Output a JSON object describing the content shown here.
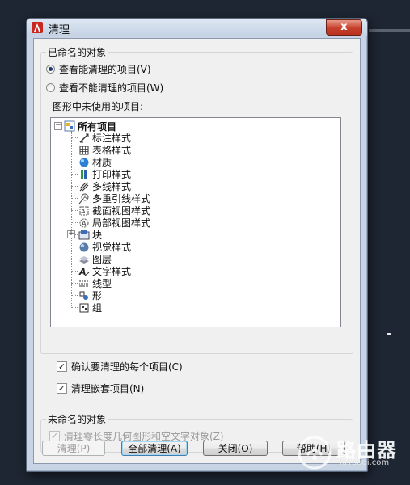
{
  "window": {
    "title": "清理",
    "close_glyph": "x"
  },
  "named_group": {
    "title": "已命名的对象",
    "radio_purgeable": "查看能清理的项目(V)",
    "radio_nonpurgeable": "查看不能清理的项目(W)",
    "selected": "purgeable",
    "tree_label": "图形中未使用的项目:"
  },
  "tree": {
    "root_label": "所有项目",
    "items": [
      {
        "label": "标注样式",
        "icon": "dimension-style-icon",
        "expandable": false
      },
      {
        "label": "表格样式",
        "icon": "table-style-icon",
        "expandable": false
      },
      {
        "label": "材质",
        "icon": "material-icon",
        "expandable": false
      },
      {
        "label": "打印样式",
        "icon": "plot-style-icon",
        "expandable": false
      },
      {
        "label": "多线样式",
        "icon": "multiline-style-icon",
        "expandable": false
      },
      {
        "label": "多重引线样式",
        "icon": "multileader-style-icon",
        "expandable": false
      },
      {
        "label": "截面视图样式",
        "icon": "section-view-style-icon",
        "expandable": false
      },
      {
        "label": "局部视图样式",
        "icon": "detail-view-style-icon",
        "expandable": false
      },
      {
        "label": "块",
        "icon": "block-icon",
        "expandable": true
      },
      {
        "label": "视觉样式",
        "icon": "visual-style-icon",
        "expandable": false
      },
      {
        "label": "图层",
        "icon": "layer-icon",
        "expandable": false
      },
      {
        "label": "文字样式",
        "icon": "text-style-icon",
        "expandable": false
      },
      {
        "label": "线型",
        "icon": "linetype-icon",
        "expandable": false
      },
      {
        "label": "形",
        "icon": "shape-icon",
        "expandable": false
      },
      {
        "label": "组",
        "icon": "group-icon",
        "expandable": false
      }
    ]
  },
  "options": {
    "confirm_each": {
      "label": "确认要清理的每个项目(C)",
      "checked": true
    },
    "purge_nested": {
      "label": "清理嵌套项目(N)",
      "checked": true
    }
  },
  "unnamed_group": {
    "title": "未命名的对象",
    "zero_length": {
      "label": "清理零长度几何图形和空文字对象(Z)",
      "checked": true,
      "disabled": true
    }
  },
  "buttons": {
    "purge": "清理(P)",
    "purge_all": "全部清理(A)",
    "close": "关闭(O)",
    "help": "帮助(H)"
  },
  "watermark": {
    "text": "路由器",
    "sub": "luyouqi.com"
  },
  "colors": {
    "title_accent": "#c7402c",
    "bg": "#1e2633",
    "dialog": "#f0f0f0"
  }
}
